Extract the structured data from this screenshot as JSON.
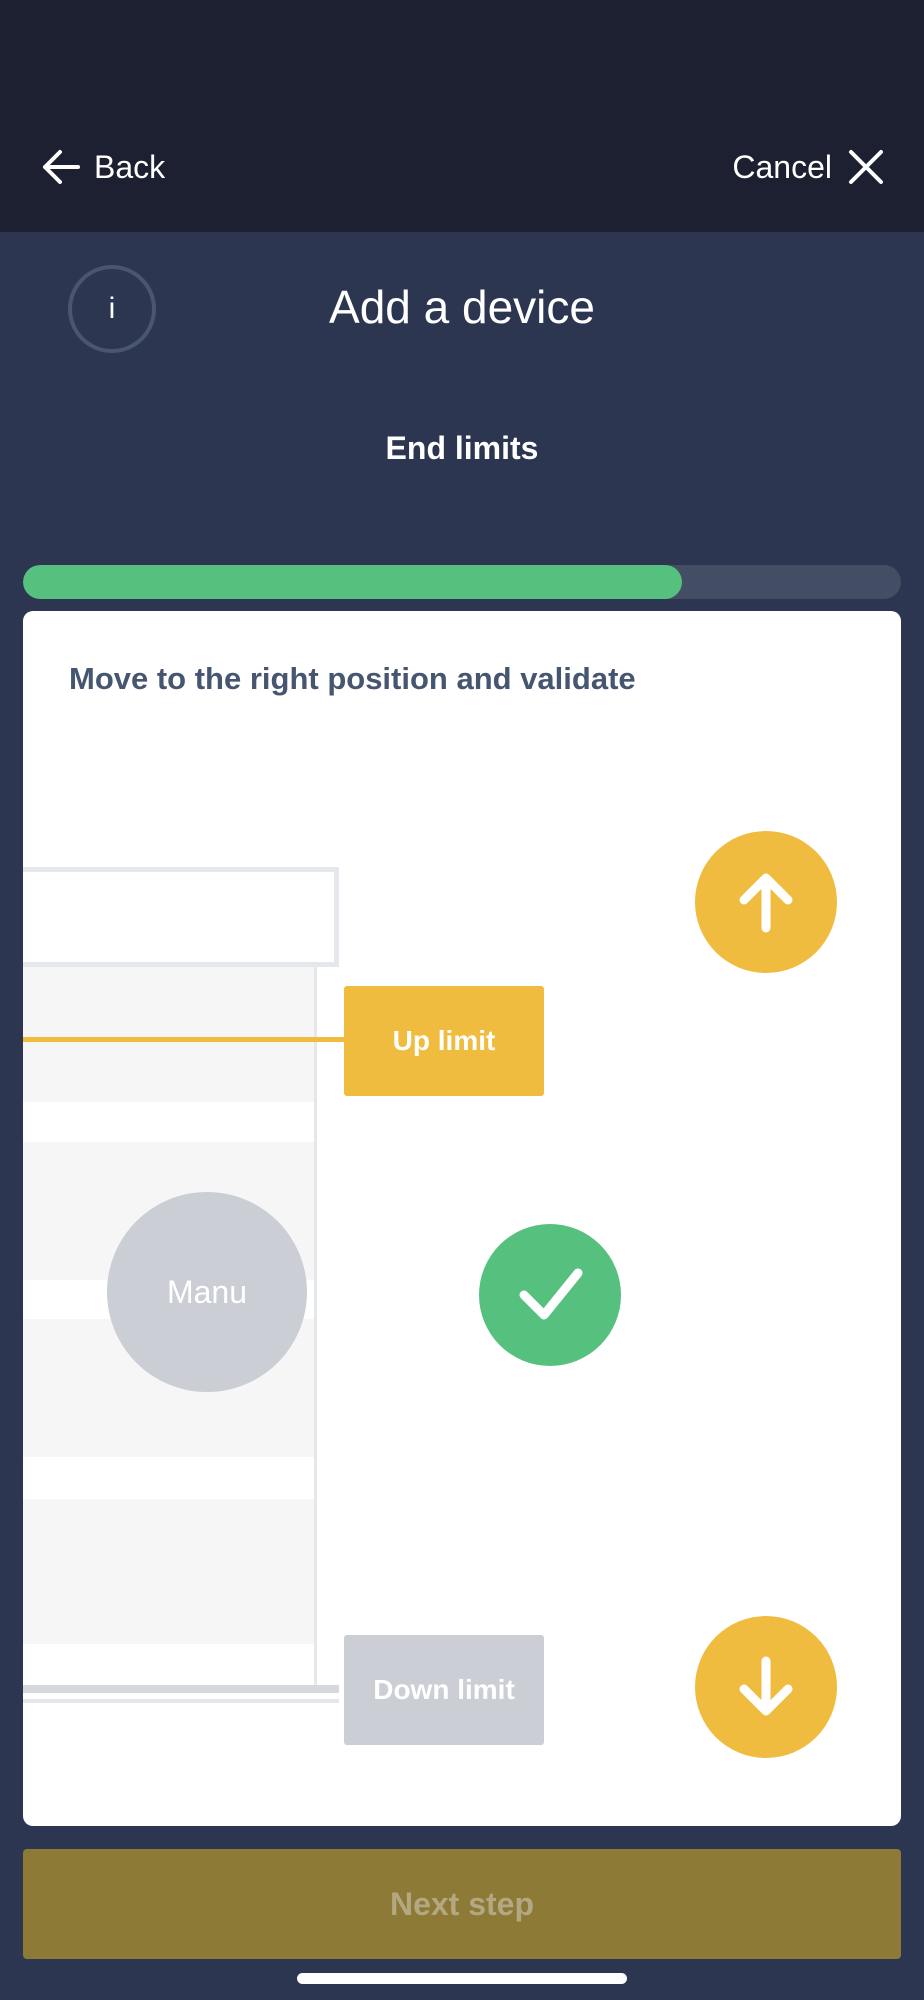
{
  "nav": {
    "back_label": "Back",
    "cancel_label": "Cancel"
  },
  "header": {
    "info_label": "i",
    "title": "Add a device",
    "step_title": "End limits"
  },
  "progress": {
    "fraction": 0.75
  },
  "card": {
    "instruction": "Move to the right position and validate",
    "up_limit_label": "Up limit",
    "down_limit_label": "Down limit",
    "manu_label": "Manu",
    "up_button_icon": "arrow-up-icon",
    "down_button_icon": "arrow-down-icon",
    "validate_button_icon": "checkmark-icon"
  },
  "footer": {
    "next_label": "Next step"
  },
  "colors": {
    "accent_yellow": "#f0bc40",
    "accent_green": "#56c07f",
    "disabled_gray": "#cbced5",
    "next_button": "#8e7a37"
  }
}
